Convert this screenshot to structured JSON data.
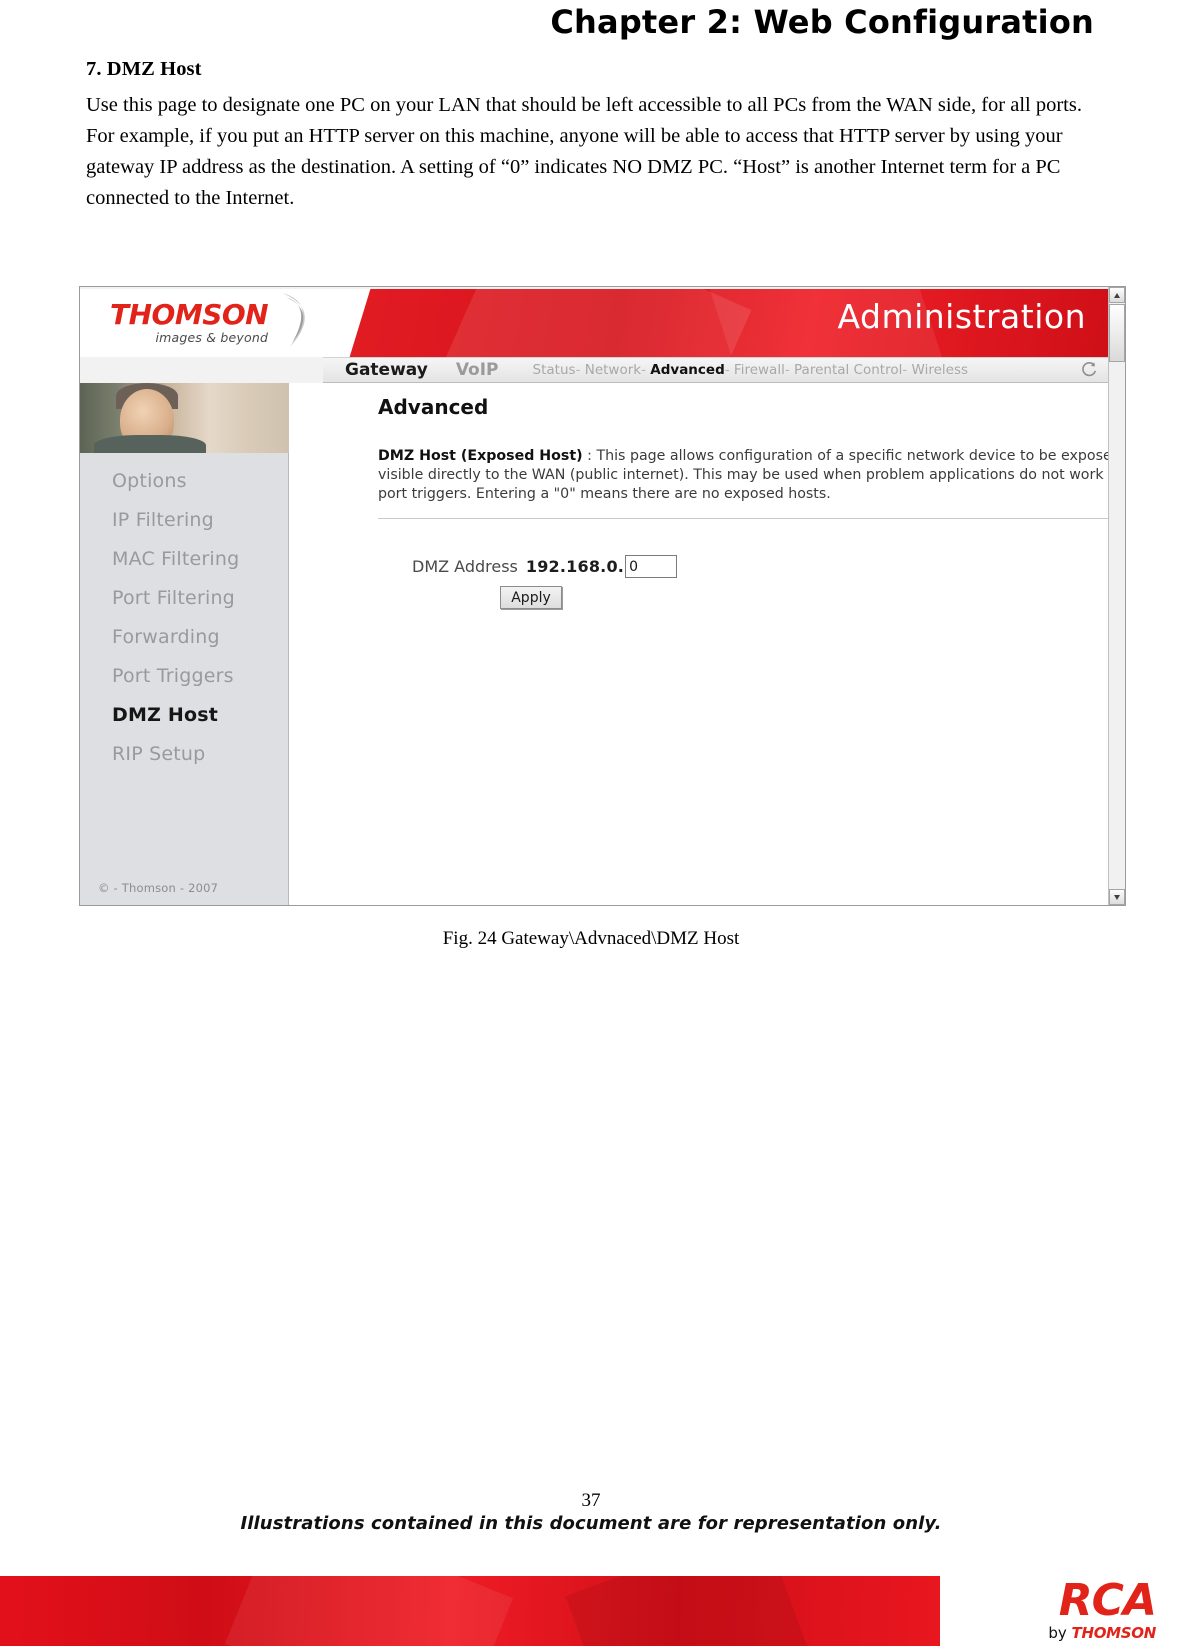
{
  "page": {
    "chapter_title": "Chapter 2: Web Configuration",
    "page_number": "37",
    "footer_note": "Illustrations contained in this document are for representation only."
  },
  "section": {
    "heading": "7. DMZ Host",
    "paragraph": "Use this page to designate one PC on your LAN that should be left accessible to all PCs from the WAN side, for all ports. For example, if you put an HTTP server on this machine, anyone will be able to access that HTTP server by using your gateway IP address as the destination. A setting of “0” indicates NO DMZ PC. “Host” is another Internet term for a PC connected to the Internet."
  },
  "figure": {
    "caption": "Fig. 24 Gateway\\Advnaced\\DMZ Host"
  },
  "screenshot": {
    "brand": {
      "name": "THOMSON",
      "tagline": "images & beyond"
    },
    "banner_title": "Administration",
    "nav": {
      "primary": "Gateway",
      "secondary": "VoIP",
      "items": [
        {
          "label": "Status",
          "active": false
        },
        {
          "label": "Network",
          "active": false
        },
        {
          "label": "Advanced",
          "active": true
        },
        {
          "label": "Firewall",
          "active": false
        },
        {
          "label": "Parental Control",
          "active": false
        },
        {
          "label": "Wireless",
          "active": false
        }
      ],
      "separator": "-",
      "refresh_icon": "refresh-icon"
    },
    "sidebar": {
      "items": [
        {
          "label": "Options",
          "active": false
        },
        {
          "label": "IP Filtering",
          "active": false
        },
        {
          "label": "MAC Filtering",
          "active": false
        },
        {
          "label": "Port Filtering",
          "active": false
        },
        {
          "label": "Forwarding",
          "active": false
        },
        {
          "label": "Port Triggers",
          "active": false
        },
        {
          "label": "DMZ Host",
          "active": true
        },
        {
          "label": "RIP Setup",
          "active": false
        }
      ],
      "copyright": "© - Thomson - 2007"
    },
    "main": {
      "heading": "Advanced",
      "desc_label": "DMZ Host (Exposed Host)",
      "desc_colon": ":",
      "desc_text": "This page allows configuration of a specific network device to be exposed or visible directly to the WAN (public internet). This may be used when problem applications do not work with port triggers. Entering a \"0\" means there are no exposed hosts.",
      "form": {
        "address_label": "DMZ Address",
        "address_prefix": "192.168.0.",
        "address_value": "0",
        "apply_label": "Apply"
      }
    },
    "scrollbar": {
      "up_icon": "arrow-up-icon",
      "down_icon": "arrow-down-icon",
      "thumb": "scrollbar-thumb"
    }
  },
  "colors": {
    "brand_red": "#e2231a",
    "banner_red": "#e31d24",
    "sidebar_bg": "#dedfe2",
    "muted_text": "#9a9a9e"
  }
}
